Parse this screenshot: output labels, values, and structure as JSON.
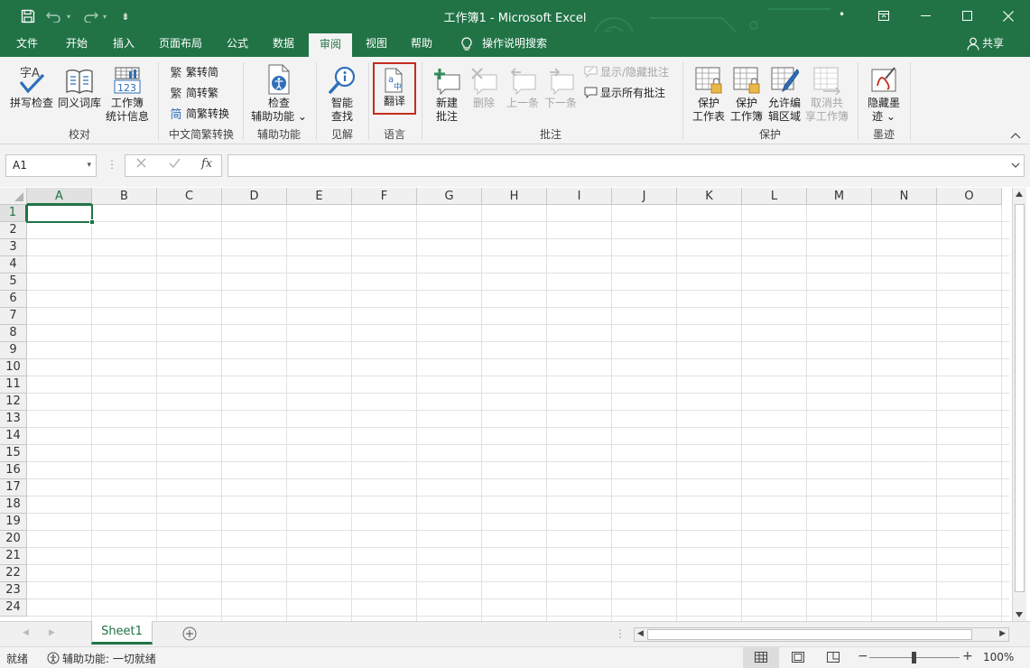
{
  "titlebar": {
    "title": "工作簿1  -  Microsoft Excel",
    "dot": "•",
    "qat_more": "⇟"
  },
  "tabs": [
    {
      "label": "文件"
    },
    {
      "label": "开始"
    },
    {
      "label": "插入"
    },
    {
      "label": "页面布局"
    },
    {
      "label": "公式"
    },
    {
      "label": "数据"
    },
    {
      "label": "审阅"
    },
    {
      "label": "视图"
    },
    {
      "label": "帮助"
    },
    {
      "label": "操作说明搜索"
    },
    {
      "label": "共享"
    }
  ],
  "ribbon": {
    "spell": "拼写检查",
    "thesaurus": "同义词库",
    "stats": "工作簿\n统计信息",
    "proof_group": "校对",
    "t2s": "繁转简",
    "s2t": "简转繁",
    "convert": "简繁转换",
    "chinese_group": "中文简繁转换",
    "check_access": "检查\n辅助功能 ⌄",
    "access_group": "辅助功能",
    "smart_lookup": "智能\n查找",
    "insights_group": "见解",
    "translate": "翻译",
    "language_group": "语言",
    "new_comment": "新建\n批注",
    "delete": "删除",
    "prev": "上一条",
    "next": "下一条",
    "show_hide_comment": "显示/隐藏批注",
    "show_all_comments": "显示所有批注",
    "comments_group": "批注",
    "protect_sheet": "保护\n工作表",
    "protect_workbook": "保护\n工作簿",
    "allow_edit": "允许编\n辑区域",
    "unshare": "取消共\n享工作簿",
    "protect_group": "保护",
    "hide_ink": "隐藏墨\n迹 ⌄",
    "ink_group": "墨迹"
  },
  "formula_bar": {
    "name_box": "A1",
    "fx": "fx",
    "formula": ""
  },
  "columns": [
    "A",
    "B",
    "C",
    "D",
    "E",
    "F",
    "G",
    "H",
    "I",
    "J",
    "K",
    "L",
    "M",
    "N",
    "O"
  ],
  "rows": [
    "1",
    "2",
    "3",
    "4",
    "5",
    "6",
    "7",
    "8",
    "9",
    "10",
    "11",
    "12",
    "13",
    "14",
    "15",
    "16",
    "17",
    "18",
    "19",
    "20",
    "21",
    "22",
    "23",
    "24"
  ],
  "sheet_tab": "Sheet1",
  "status": {
    "ready": "就绪",
    "accessibility": "辅助功能: 一切就绪",
    "zoom": "100%"
  },
  "colors": {
    "accent": "#217346",
    "highlight_border": "#c42b1c"
  }
}
